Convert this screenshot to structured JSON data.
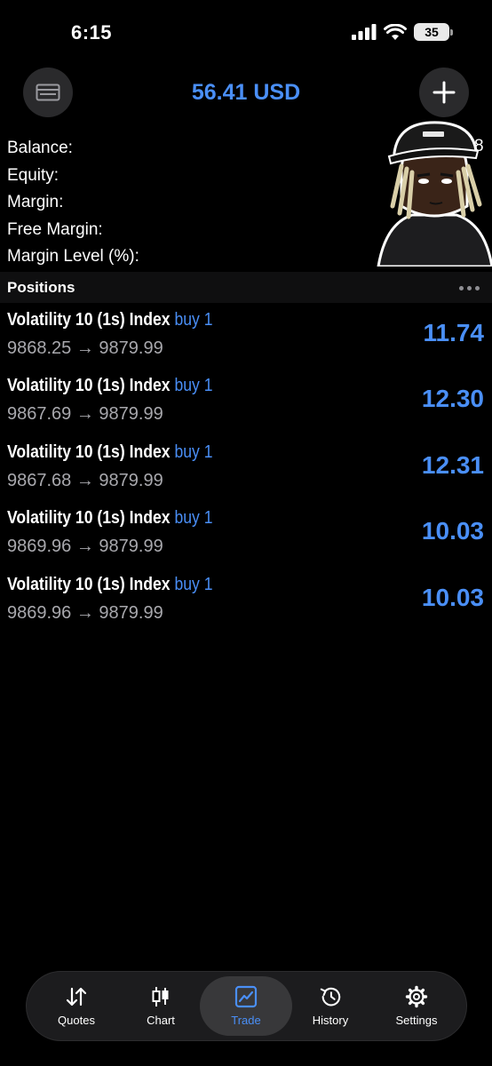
{
  "status_bar": {
    "time": "6:15",
    "battery": "35"
  },
  "header": {
    "account_title": "56.41 USD"
  },
  "summary": {
    "balance_label": "Balance:",
    "equity_label": "Equity:",
    "margin_label": "Margin:",
    "free_margin_label": "Free Margin:",
    "margin_level_label": "Margin Level (%):",
    "partial_value": "8"
  },
  "positions": {
    "label": "Positions",
    "items": [
      {
        "symbol": "Volatility 10 (1s) Index",
        "direction": "buy 1",
        "open": "9868.25",
        "arrow": "→",
        "current": "9879.99",
        "profit": "11.74"
      },
      {
        "symbol": "Volatility 10 (1s) Index",
        "direction": "buy 1",
        "open": "9867.69",
        "arrow": "→",
        "current": "9879.99",
        "profit": "12.30"
      },
      {
        "symbol": "Volatility 10 (1s) Index",
        "direction": "buy 1",
        "open": "9867.68",
        "arrow": "→",
        "current": "9879.99",
        "profit": "12.31"
      },
      {
        "symbol": "Volatility 10 (1s) Index",
        "direction": "buy 1",
        "open": "9869.96",
        "arrow": "→",
        "current": "9879.99",
        "profit": "10.03"
      },
      {
        "symbol": "Volatility 10 (1s) Index",
        "direction": "buy 1",
        "open": "9869.96",
        "arrow": "→",
        "current": "9879.99",
        "profit": "10.03"
      }
    ]
  },
  "tabs": [
    {
      "label": "Quotes",
      "icon": "quotes-icon"
    },
    {
      "label": "Chart",
      "icon": "chart-icon"
    },
    {
      "label": "Trade",
      "icon": "trade-icon",
      "active": true
    },
    {
      "label": "History",
      "icon": "history-icon"
    },
    {
      "label": "Settings",
      "icon": "settings-icon"
    }
  ],
  "colors": {
    "accent": "#4a8ff7",
    "background": "#000000",
    "secondary_text": "#a8a8ad"
  }
}
